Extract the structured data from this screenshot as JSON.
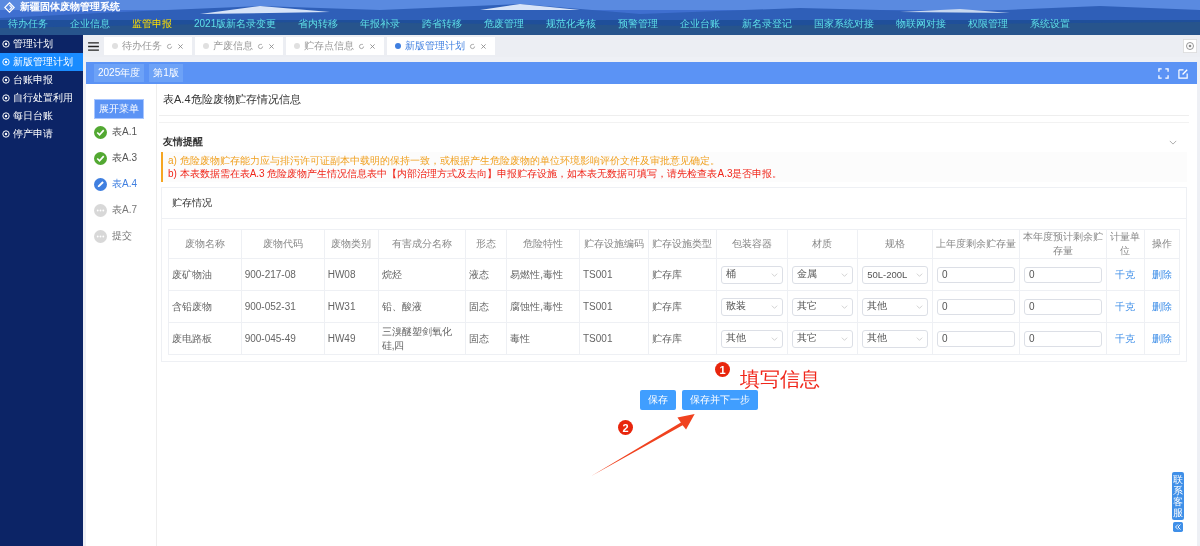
{
  "app": {
    "title": "新疆固体废物管理系统"
  },
  "nav": [
    {
      "label": "待办任务",
      "selected": false
    },
    {
      "label": "企业信息",
      "selected": false
    },
    {
      "label": "监管申报",
      "selected": true
    },
    {
      "label": "2021版新名录变更",
      "selected": false
    },
    {
      "label": "省内转移",
      "selected": false
    },
    {
      "label": "年报补录",
      "selected": false
    },
    {
      "label": "跨省转移",
      "selected": false
    },
    {
      "label": "危废管理",
      "selected": false
    },
    {
      "label": "规范化考核",
      "selected": false
    },
    {
      "label": "预警管理",
      "selected": false
    },
    {
      "label": "企业台账",
      "selected": false
    },
    {
      "label": "新名录登记",
      "selected": false
    },
    {
      "label": "国家系统对接",
      "selected": false
    },
    {
      "label": "物联网对接",
      "selected": false
    },
    {
      "label": "权限管理",
      "selected": false
    },
    {
      "label": "系统设置",
      "selected": false
    }
  ],
  "sidebar": {
    "items": [
      {
        "label": "管理计划",
        "selected": false
      },
      {
        "label": "新版管理计划",
        "selected": true
      },
      {
        "label": "台账申报",
        "selected": false
      },
      {
        "label": "自行处置利用",
        "selected": false
      },
      {
        "label": "每日台账",
        "selected": false
      },
      {
        "label": "停产申请",
        "selected": false
      }
    ]
  },
  "tabs": [
    {
      "label": "待办任务",
      "selected": false
    },
    {
      "label": "产废信息",
      "selected": false
    },
    {
      "label": "贮存点信息",
      "selected": false
    },
    {
      "label": "新版管理计划",
      "selected": true
    }
  ],
  "plan_bar": {
    "year": "2025年度",
    "version": "第1版"
  },
  "steps": {
    "toggle": "展开菜单",
    "items": [
      {
        "label": "表A.1",
        "completed": true,
        "selected": false
      },
      {
        "label": "表A.3",
        "completed": true,
        "selected": false
      },
      {
        "label": "表A.4",
        "completed": false,
        "selected": true
      },
      {
        "label": "表A.7",
        "completed": false,
        "selected": false
      },
      {
        "label": "提交",
        "completed": false,
        "selected": false
      }
    ]
  },
  "form": {
    "title": "表A.4危险废物贮存情况信息",
    "reminder": {
      "title": "友情提醒",
      "expanded": true,
      "notes": [
        {
          "kind": "warning",
          "text": "a) 危险废物贮存能力应与排污许可证副本中载明的保持一致，或根据产生危险废物的单位环境影响评价文件及审批意见确定。"
        },
        {
          "kind": "error",
          "text": "b) 本表数据需在表A.3 危险废物产生情况信息表中【内部治理方式及去向】申报贮存设施，如本表无数据可填写，请先检查表A.3是否申报。"
        }
      ]
    },
    "section": "贮存情况",
    "columns": [
      "废物名称",
      "废物代码",
      "废物类别",
      "有害成分名称",
      "形态",
      "危险特性",
      "贮存设施编码",
      "贮存设施类型",
      "包装容器",
      "材质",
      "规格",
      "上年度剩余贮存量",
      "本年度预计剩余贮存量",
      "计量单位",
      "操作"
    ],
    "rows": [
      {
        "name": "废矿物油",
        "code": "900-217-08",
        "category": "HW08",
        "component": "烷烃",
        "form": "液态",
        "hazard": "易燃性,毒性",
        "facility_code": "TS001",
        "facility_type": "贮存库",
        "container": "桶",
        "material": "金属",
        "spec": "50L-200L",
        "last_year": "0",
        "this_year": "0",
        "unit": "千克",
        "action": "删除"
      },
      {
        "name": "含铅废物",
        "code": "900-052-31",
        "category": "HW31",
        "component": "铅、酸液",
        "form": "固态",
        "hazard": "腐蚀性,毒性",
        "facility_code": "TS001",
        "facility_type": "贮存库",
        "container": "散装",
        "material": "其它",
        "spec": "其他",
        "last_year": "0",
        "this_year": "0",
        "unit": "千克",
        "action": "删除"
      },
      {
        "name": "废电路板",
        "code": "900-045-49",
        "category": "HW49",
        "component": "三溴醚塑剑氧化硅,四",
        "form": "固态",
        "hazard": "毒性",
        "facility_code": "TS001",
        "facility_type": "贮存库",
        "container": "其他",
        "material": "其它",
        "spec": "其他",
        "last_year": "0",
        "this_year": "0",
        "unit": "千克",
        "action": "删除"
      }
    ],
    "buttons": [
      {
        "label": "保存"
      },
      {
        "label": "保存并下一步"
      }
    ]
  },
  "annotations": [
    {
      "number": "1",
      "text": "填写信息"
    },
    {
      "number": "2"
    }
  ],
  "contact": {
    "label": "联系客服"
  }
}
